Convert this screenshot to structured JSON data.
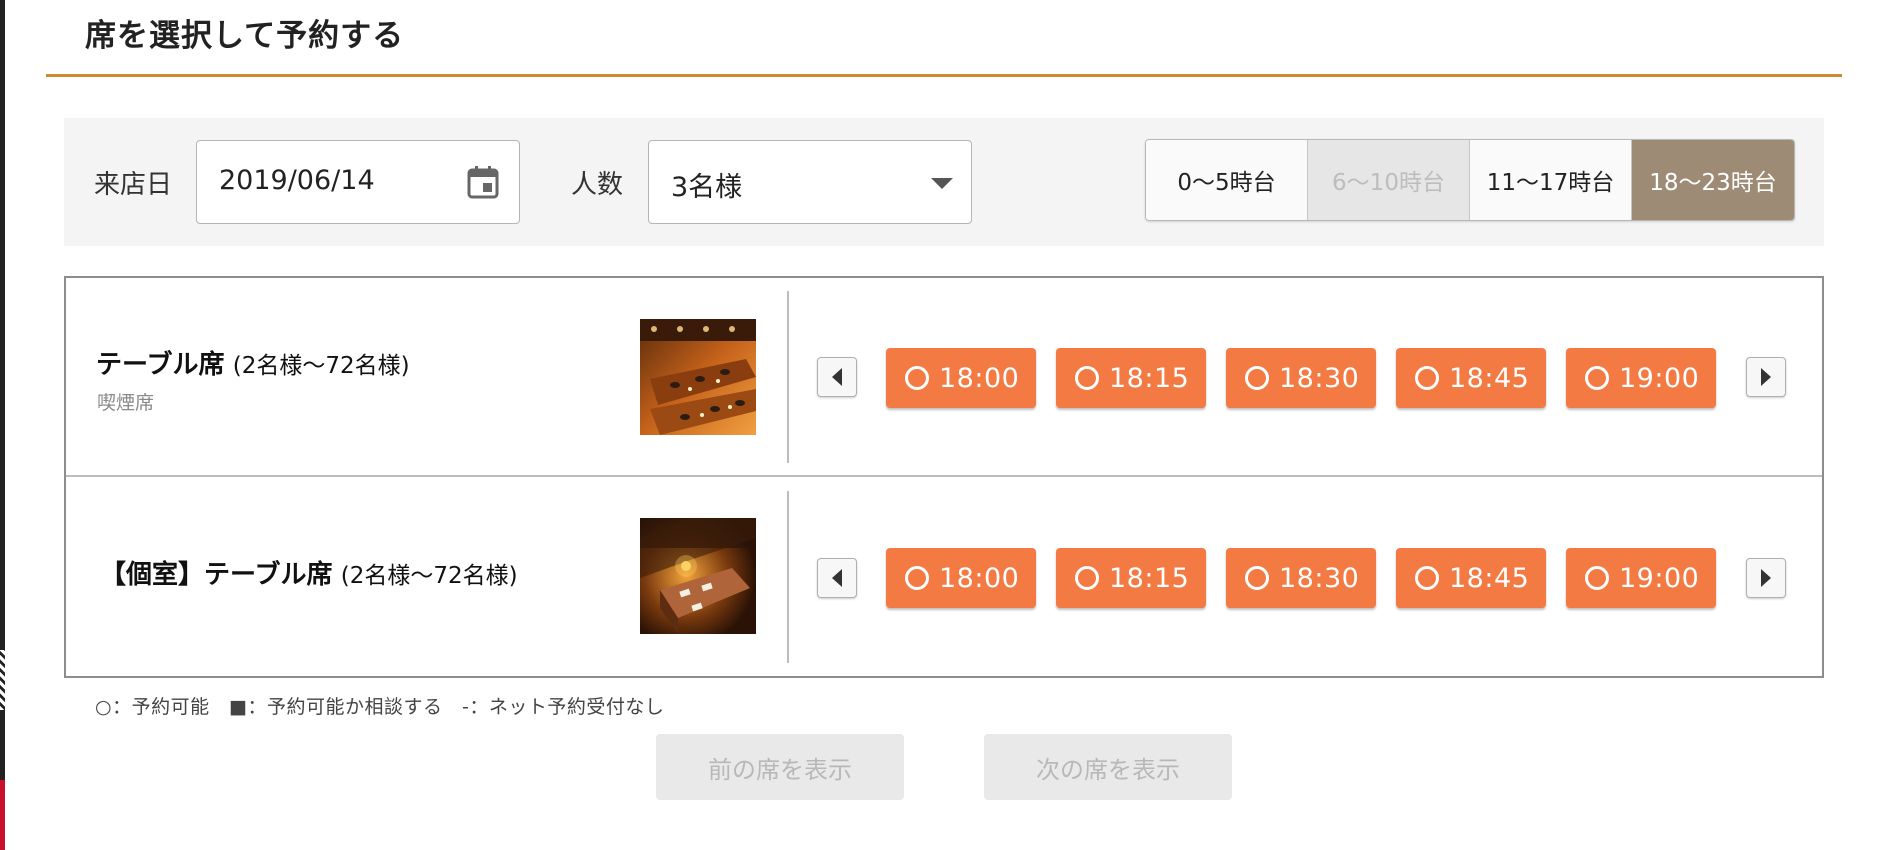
{
  "page_title": "席を選択して予約する",
  "filters": {
    "date_label": "来店日",
    "date_value": "2019/06/14",
    "party_label": "人数",
    "party_value": "3名様",
    "hour_ranges": [
      {
        "label": "0〜5時台",
        "state": "normal"
      },
      {
        "label": "6〜10時台",
        "state": "disabled"
      },
      {
        "label": "11〜17時台",
        "state": "normal"
      },
      {
        "label": "18〜23時台",
        "state": "selected"
      }
    ]
  },
  "seats": [
    {
      "name": "テーブル席",
      "capacity": "(2名様〜72名様)",
      "note": "喫煙席",
      "photo_icon": "restaurant-table-photo",
      "slots": [
        {
          "status": "○",
          "time": "18:00"
        },
        {
          "status": "○",
          "time": "18:15"
        },
        {
          "status": "○",
          "time": "18:30"
        },
        {
          "status": "○",
          "time": "18:45"
        },
        {
          "status": "○",
          "time": "19:00"
        }
      ]
    },
    {
      "name": "【個室】テーブル席",
      "capacity": "(2名様〜72名様)",
      "note": "",
      "photo_icon": "private-room-photo",
      "slots": [
        {
          "status": "○",
          "time": "18:00"
        },
        {
          "status": "○",
          "time": "18:15"
        },
        {
          "status": "○",
          "time": "18:30"
        },
        {
          "status": "○",
          "time": "18:45"
        },
        {
          "status": "○",
          "time": "19:00"
        }
      ]
    }
  ],
  "legend": "○：予約可能　■：予約可能か相談する　-：ネット予約受付なし",
  "pager": {
    "prev_label": "前の席を表示",
    "next_label": "次の席を表示"
  },
  "colors": {
    "accent_rule": "#d08a2e",
    "slot_bg": "#f47a44",
    "selected_range_bg": "#9e8b76",
    "disabled_range_bg": "#e6e6e6"
  }
}
